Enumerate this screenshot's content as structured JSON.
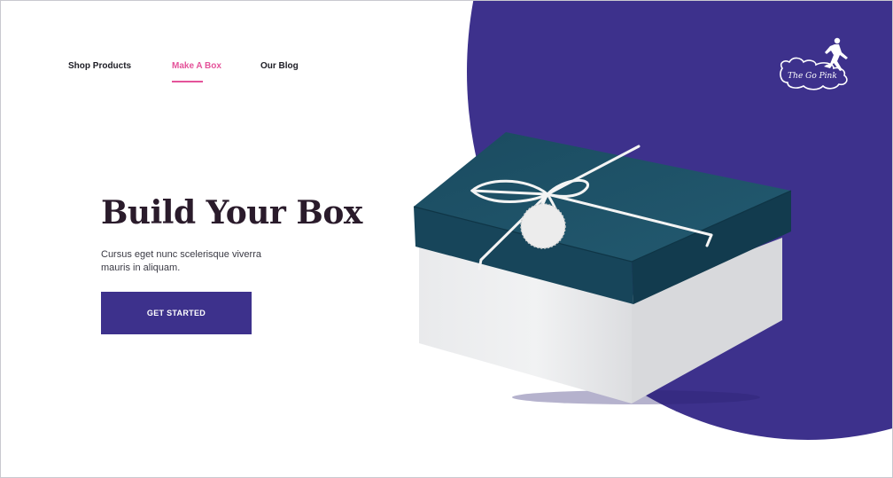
{
  "nav": {
    "items": [
      {
        "label": "Shop Products",
        "active": false
      },
      {
        "label": "Make A Box",
        "active": true
      },
      {
        "label": "Our Blog",
        "active": false
      }
    ]
  },
  "logo": {
    "text": "The Go Pink",
    "icon": "runner-logo-icon"
  },
  "hero": {
    "title": "Build Your Box",
    "description": "Cursus eget nunc scelerisque viverra mauris in aliquam.",
    "cta_label": "GET STARTED",
    "image": "gift-box-image"
  },
  "colors": {
    "accent": "#3d318c",
    "pink": "#e4539a",
    "box_lid": "#1e5266",
    "heading": "#2a1b2b"
  }
}
